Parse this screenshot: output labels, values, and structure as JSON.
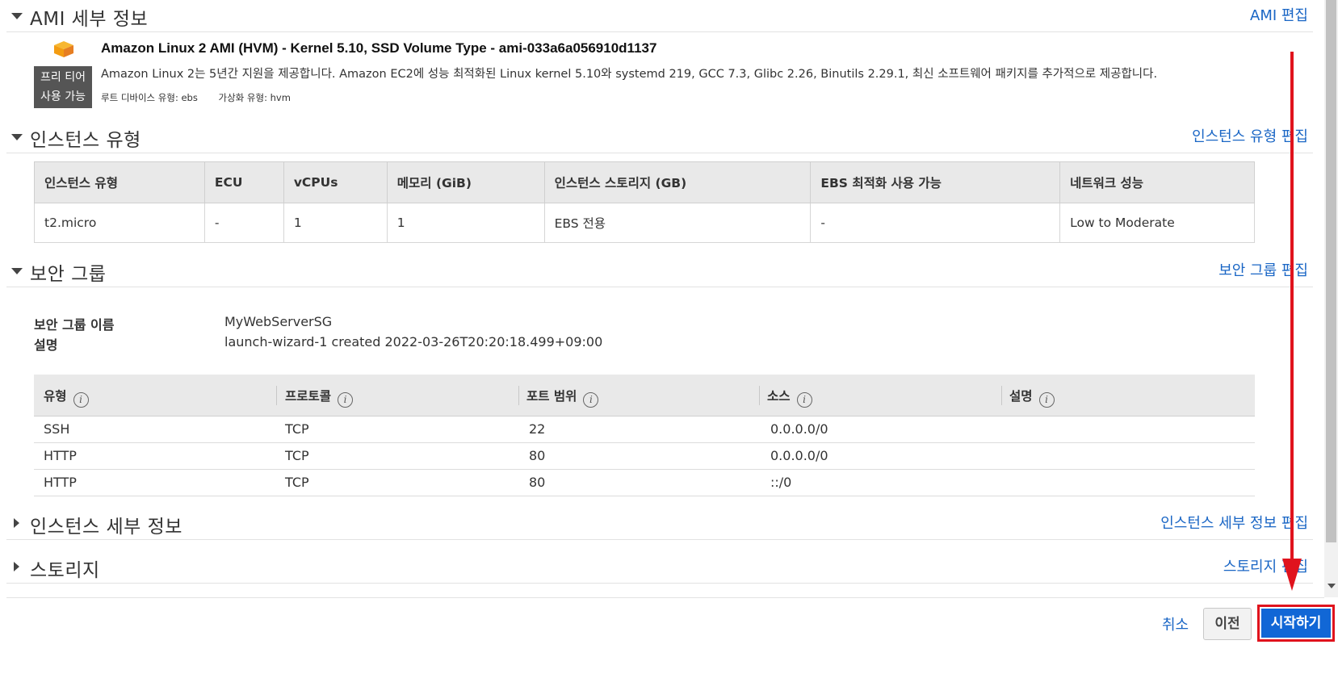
{
  "ami": {
    "section_title": "AMI 세부 정보",
    "edit_label": "AMI 편집",
    "free_tier_line1": "프리 티어",
    "free_tier_line2": "사용 가능",
    "title": "Amazon Linux 2 AMI (HVM) - Kernel 5.10, SSD Volume Type - ami-033a6a056910d1137",
    "description": "Amazon Linux 2는 5년간 지원을 제공합니다. Amazon EC2에 성능 최적화된 Linux kernel 5.10와 systemd 219, GCC 7.3, Glibc 2.26, Binutils 2.29.1, 최신 소프트웨어 패키지를 추가적으로 제공합니다.",
    "root_device": "루트 디바이스 유형: ebs",
    "virtualization": "가상화 유형: hvm"
  },
  "instance_type": {
    "section_title": "인스턴스 유형",
    "edit_label": "인스턴스 유형 편집",
    "headers": [
      "인스턴스 유형",
      "ECU",
      "vCPUs",
      "메모리 (GiB)",
      "인스턴스 스토리지 (GB)",
      "EBS 최적화 사용 가능",
      "네트워크 성능"
    ],
    "row": [
      "t2.micro",
      "-",
      "1",
      "1",
      "EBS 전용",
      "-",
      "Low to Moderate"
    ]
  },
  "security_group": {
    "section_title": "보안 그룹",
    "edit_label": "보안 그룹 편집",
    "name_label": "보안 그룹 이름",
    "name_value": "MyWebServerSG",
    "desc_label": "설명",
    "desc_value": "launch-wizard-1 created 2022-03-26T20:20:18.499+09:00",
    "rule_headers": [
      "유형",
      "프로토콜",
      "포트 범위",
      "소스",
      "설명"
    ],
    "info_glyph": "i",
    "rules": [
      [
        "SSH",
        "TCP",
        "22",
        "0.0.0.0/0",
        ""
      ],
      [
        "HTTP",
        "TCP",
        "80",
        "0.0.0.0/0",
        ""
      ],
      [
        "HTTP",
        "TCP",
        "80",
        "::/0",
        ""
      ]
    ]
  },
  "instance_details": {
    "section_title": "인스턴스 세부 정보",
    "edit_label": "인스턴스 세부 정보 편집"
  },
  "storage": {
    "section_title": "스토리지",
    "edit_label": "스토리지 편집"
  },
  "footer": {
    "cancel_label": "취소",
    "prev_label": "이전",
    "launch_label": "시작하기"
  },
  "colors": {
    "link": "#1a66c5",
    "primary_button": "#1167d6",
    "annotation_red": "#e0131d",
    "free_tier_badge": "#555555"
  },
  "icons": {
    "ami": "cube-icon",
    "info": "info-icon",
    "expanded": "caret-down-icon",
    "collapsed": "caret-right-icon"
  }
}
